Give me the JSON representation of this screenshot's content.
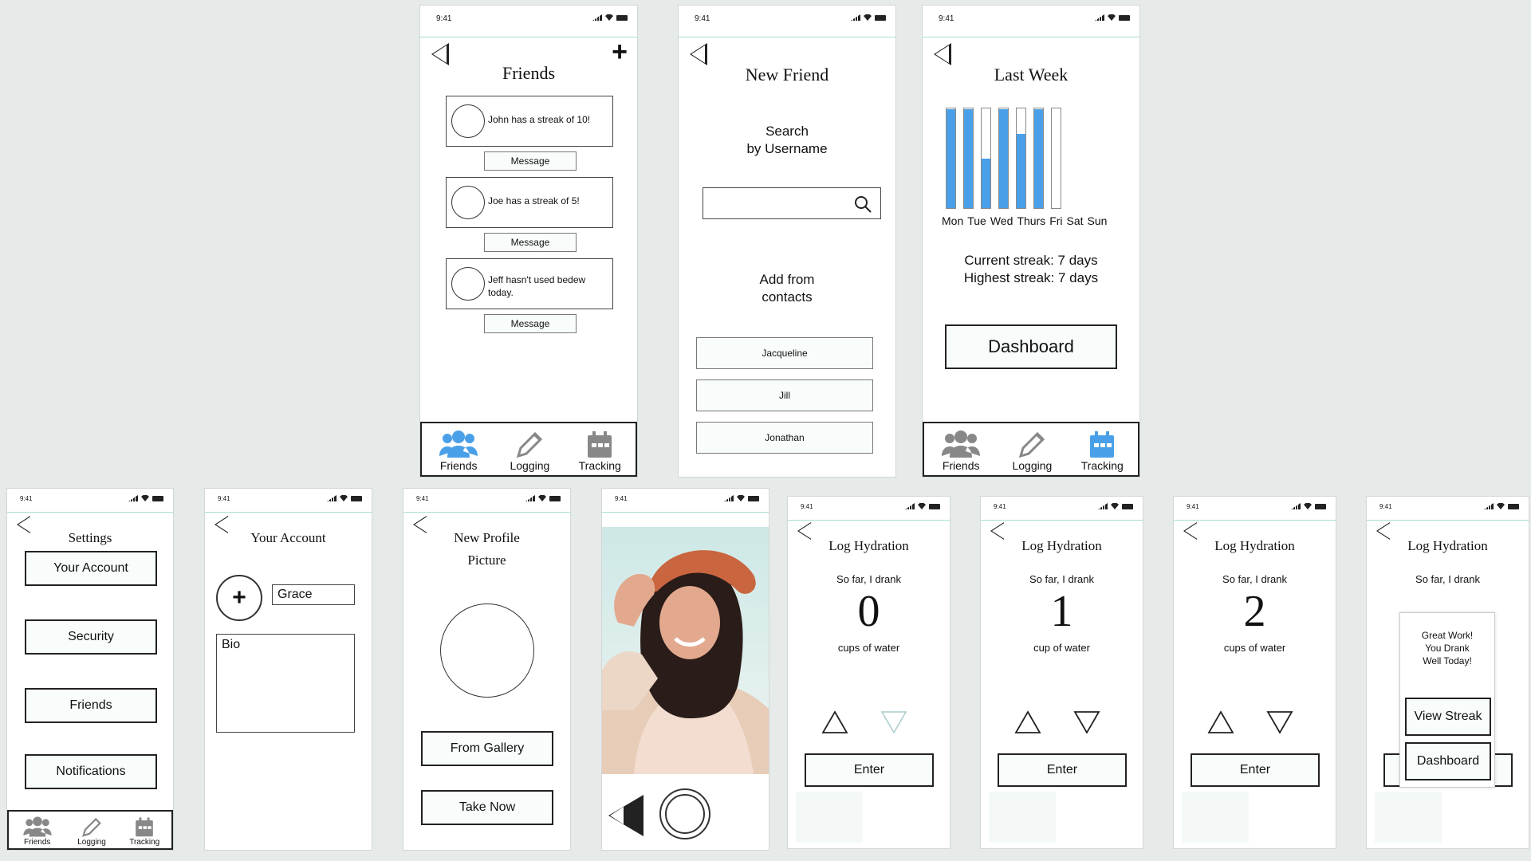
{
  "status": {
    "time": "9:41"
  },
  "friends": {
    "title": "Friends",
    "items": [
      {
        "text": "John has a streak of 10!",
        "button": "Message"
      },
      {
        "text": "Joe has a streak of 5!",
        "button": "Message"
      },
      {
        "text": "Jeff hasn't used bedew today.",
        "button": "Message"
      }
    ]
  },
  "nav": {
    "friends": "Friends",
    "logging": "Logging",
    "tracking": "Tracking"
  },
  "new_friend": {
    "title": "New Friend",
    "search_label_1": "Search",
    "search_label_2": "by Username",
    "contacts_label_1": "Add from",
    "contacts_label_2": "contacts",
    "contacts": [
      "Jacqueline",
      "Jill",
      "Jonathan"
    ]
  },
  "last_week": {
    "title": "Last Week",
    "days": [
      "Mon",
      "Tue",
      "Wed",
      "Thurs",
      "Fri",
      "Sat",
      "Sun"
    ],
    "current_streak": "Current streak: 7 days",
    "highest_streak": "Highest streak: 7 days",
    "dashboard": "Dashboard"
  },
  "chart_data": {
    "type": "bar",
    "categories": [
      "Mon",
      "Tue",
      "Wed",
      "Thurs",
      "Fri",
      "Sat",
      "Sun"
    ],
    "values": [
      1.0,
      1.0,
      0.5,
      1.0,
      0.75,
      1.0,
      0.0
    ],
    "ylim": [
      0,
      1
    ],
    "colors": {
      "fill": "#4aa0e8"
    }
  },
  "settings": {
    "title": "Settings",
    "items": [
      "Your Account",
      "Security",
      "Friends",
      "Notifications"
    ]
  },
  "your_account": {
    "title": "Your Account",
    "name": "Grace",
    "bio": "Bio"
  },
  "new_profile": {
    "title_1": "New Profile",
    "title_2": "Picture",
    "gallery": "From Gallery",
    "take_now": "Take Now"
  },
  "log": {
    "title": "Log Hydration",
    "so_far": "So far, I drank",
    "enter": "Enter",
    "screens": [
      {
        "count": "0",
        "unit": "cups of water"
      },
      {
        "count": "1",
        "unit": "cup of water"
      },
      {
        "count": "2",
        "unit": "cups of water"
      }
    ],
    "popup": {
      "line1": "Great Work!",
      "line2": "You Drank",
      "line3": "Well Today!",
      "view": "View Streak",
      "dashboard": "Dashboard"
    }
  }
}
